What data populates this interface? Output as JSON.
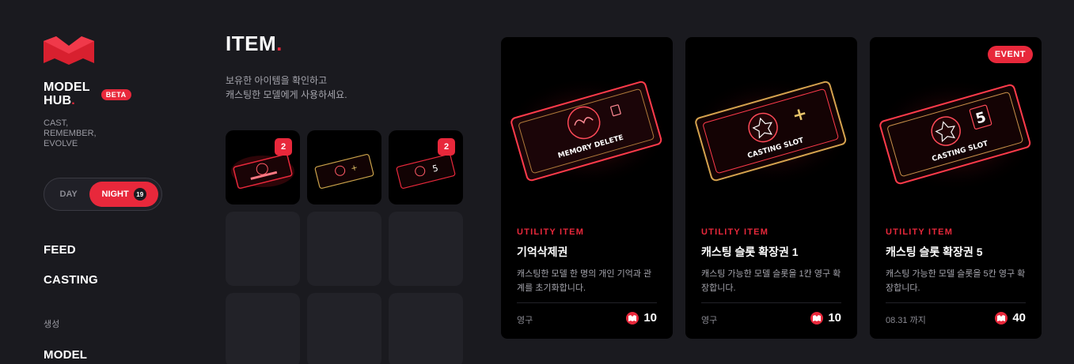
{
  "sidebar": {
    "brand_line1": "MODEL",
    "brand_line2": "HUB",
    "brand_dot": ".",
    "beta": "BETA",
    "tagline": "CAST,\nREMEMBER,\nEVOLVE",
    "toggle": {
      "day": "DAY",
      "night": "NIGHT",
      "night_badge": "19"
    },
    "nav": {
      "feed": "FEED",
      "casting": "CASTING",
      "section": "생성",
      "model": "MODEL"
    }
  },
  "main": {
    "title": "ITEM",
    "title_dot": ".",
    "description": "보유한 아이템을 확인하고\n캐스팅한 모델에게 사용하세요.",
    "inventory": [
      {
        "icon": "memory-delete-ticket-icon",
        "count": "2"
      },
      {
        "icon": "casting-slot-plus-ticket-icon",
        "count": ""
      },
      {
        "icon": "casting-slot-5-ticket-icon",
        "count": "2"
      }
    ]
  },
  "cards": [
    {
      "art_label": "MEMORY DELETE",
      "art_icon": "memory-delete-ticket-icon",
      "category": "UTILITY ITEM",
      "name": "기억삭제권",
      "description": "캐스팅한 모델 한 명의 개인 기억과 관계를 초기화합니다.",
      "period": "영구",
      "price": "10",
      "event": ""
    },
    {
      "art_label": "CASTING SLOT",
      "art_icon": "casting-slot-plus-ticket-icon",
      "category": "UTILITY ITEM",
      "name": "캐스팅 슬롯 확장권 1",
      "description": "캐스팅 가능한 모델 슬롯을 1칸 영구 확장합니다.",
      "period": "영구",
      "price": "10",
      "event": ""
    },
    {
      "art_label": "CASTING SLOT",
      "art_icon": "casting-slot-5-ticket-icon",
      "category": "UTILITY ITEM",
      "name": "캐스팅 슬롯 확장권 5",
      "description": "캐스팅 가능한 모델 슬롯을 5칸 영구 확장합니다.",
      "period": "08.31 까지",
      "price": "40",
      "event": "EVENT"
    }
  ],
  "colors": {
    "accent": "#e8283b",
    "background": "#1a1a1f",
    "card": "#000000",
    "slot": "#222228"
  }
}
